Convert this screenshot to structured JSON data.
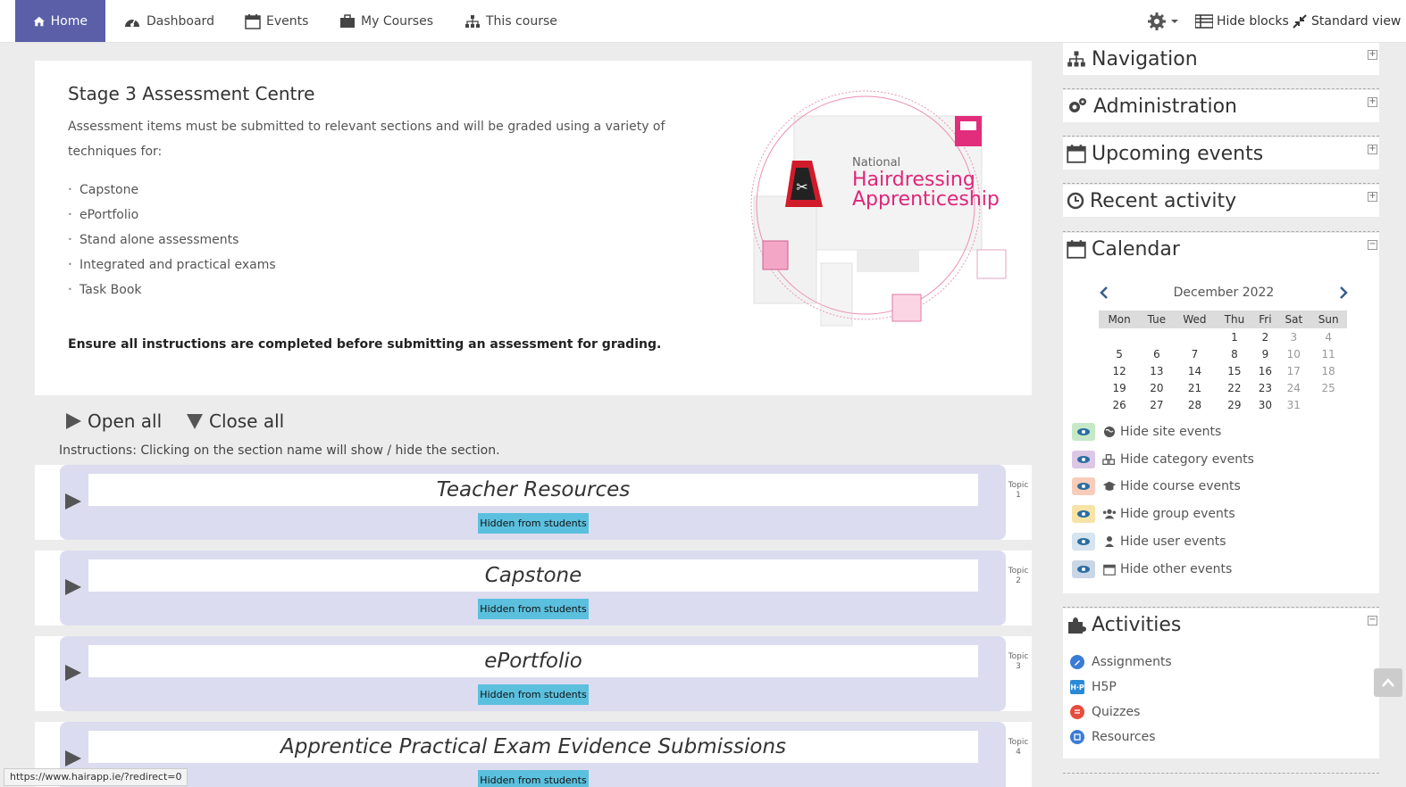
{
  "nav": {
    "home": "Home",
    "dashboard": "Dashboard",
    "events": "Events",
    "my_courses": "My Courses",
    "this_course": "This course",
    "hide_blocks": "Hide blocks",
    "standard_view": "Standard view"
  },
  "card": {
    "title": "Stage 3 Assessment Centre",
    "intro": "Assessment items must be submitted to relevant sections and will be graded using a variety of techniques for:",
    "items": [
      "Capstone",
      "ePortfolio",
      "Stand alone assessments",
      "Integrated and practical exams",
      "Task Book"
    ],
    "note": "Ensure all instructions are completed before submitting an assessment for grading.",
    "logo": {
      "line1": "National",
      "line2": "Hairdressing",
      "line3": "Apprenticeship"
    }
  },
  "controls": {
    "open_all": "Open all",
    "close_all": "Close all",
    "instructions": "Instructions: Clicking on the section name will show / hide the section."
  },
  "sections": [
    {
      "title": "Teacher Resources",
      "badge": "Hidden from students",
      "topic": "Topic",
      "num": "1"
    },
    {
      "title": "Capstone",
      "badge": "Hidden from students",
      "topic": "Topic",
      "num": "2"
    },
    {
      "title": "ePortfolio",
      "badge": "Hidden from students",
      "topic": "Topic",
      "num": "3"
    },
    {
      "title": "Apprentice Practical Exam Evidence Submissions",
      "badge": "Hidden from students",
      "topic": "Topic",
      "num": "4"
    }
  ],
  "blocks": {
    "navigation": "Navigation",
    "administration": "Administration",
    "upcoming": "Upcoming events",
    "recent": "Recent activity",
    "calendar": "Calendar",
    "activities": "Activities"
  },
  "calendar": {
    "month": "December 2022",
    "days": [
      "Mon",
      "Tue",
      "Wed",
      "Thu",
      "Fri",
      "Sat",
      "Sun"
    ],
    "weeks": [
      [
        "",
        "",
        "",
        "1",
        "2",
        "3",
        "4"
      ],
      [
        "5",
        "6",
        "7",
        "8",
        "9",
        "10",
        "11"
      ],
      [
        "12",
        "13",
        "14",
        "15",
        "16",
        "17",
        "18"
      ],
      [
        "19",
        "20",
        "21",
        "22",
        "23",
        "24",
        "25"
      ],
      [
        "26",
        "27",
        "28",
        "29",
        "30",
        "31",
        ""
      ]
    ]
  },
  "event_filters": [
    {
      "label": "Hide site events",
      "color": "#c6e8c6"
    },
    {
      "label": "Hide category events",
      "color": "#dcc8e6"
    },
    {
      "label": "Hide course events",
      "color": "#f7cdb9"
    },
    {
      "label": "Hide group events",
      "color": "#f8e3a6"
    },
    {
      "label": "Hide user events",
      "color": "#d5e4ef"
    },
    {
      "label": "Hide other events",
      "color": "#c9d6e6"
    }
  ],
  "activities": [
    "Assignments",
    "H5P",
    "Quizzes",
    "Resources"
  ],
  "status_url": "https://www.hairapp.ie/?redirect=0"
}
